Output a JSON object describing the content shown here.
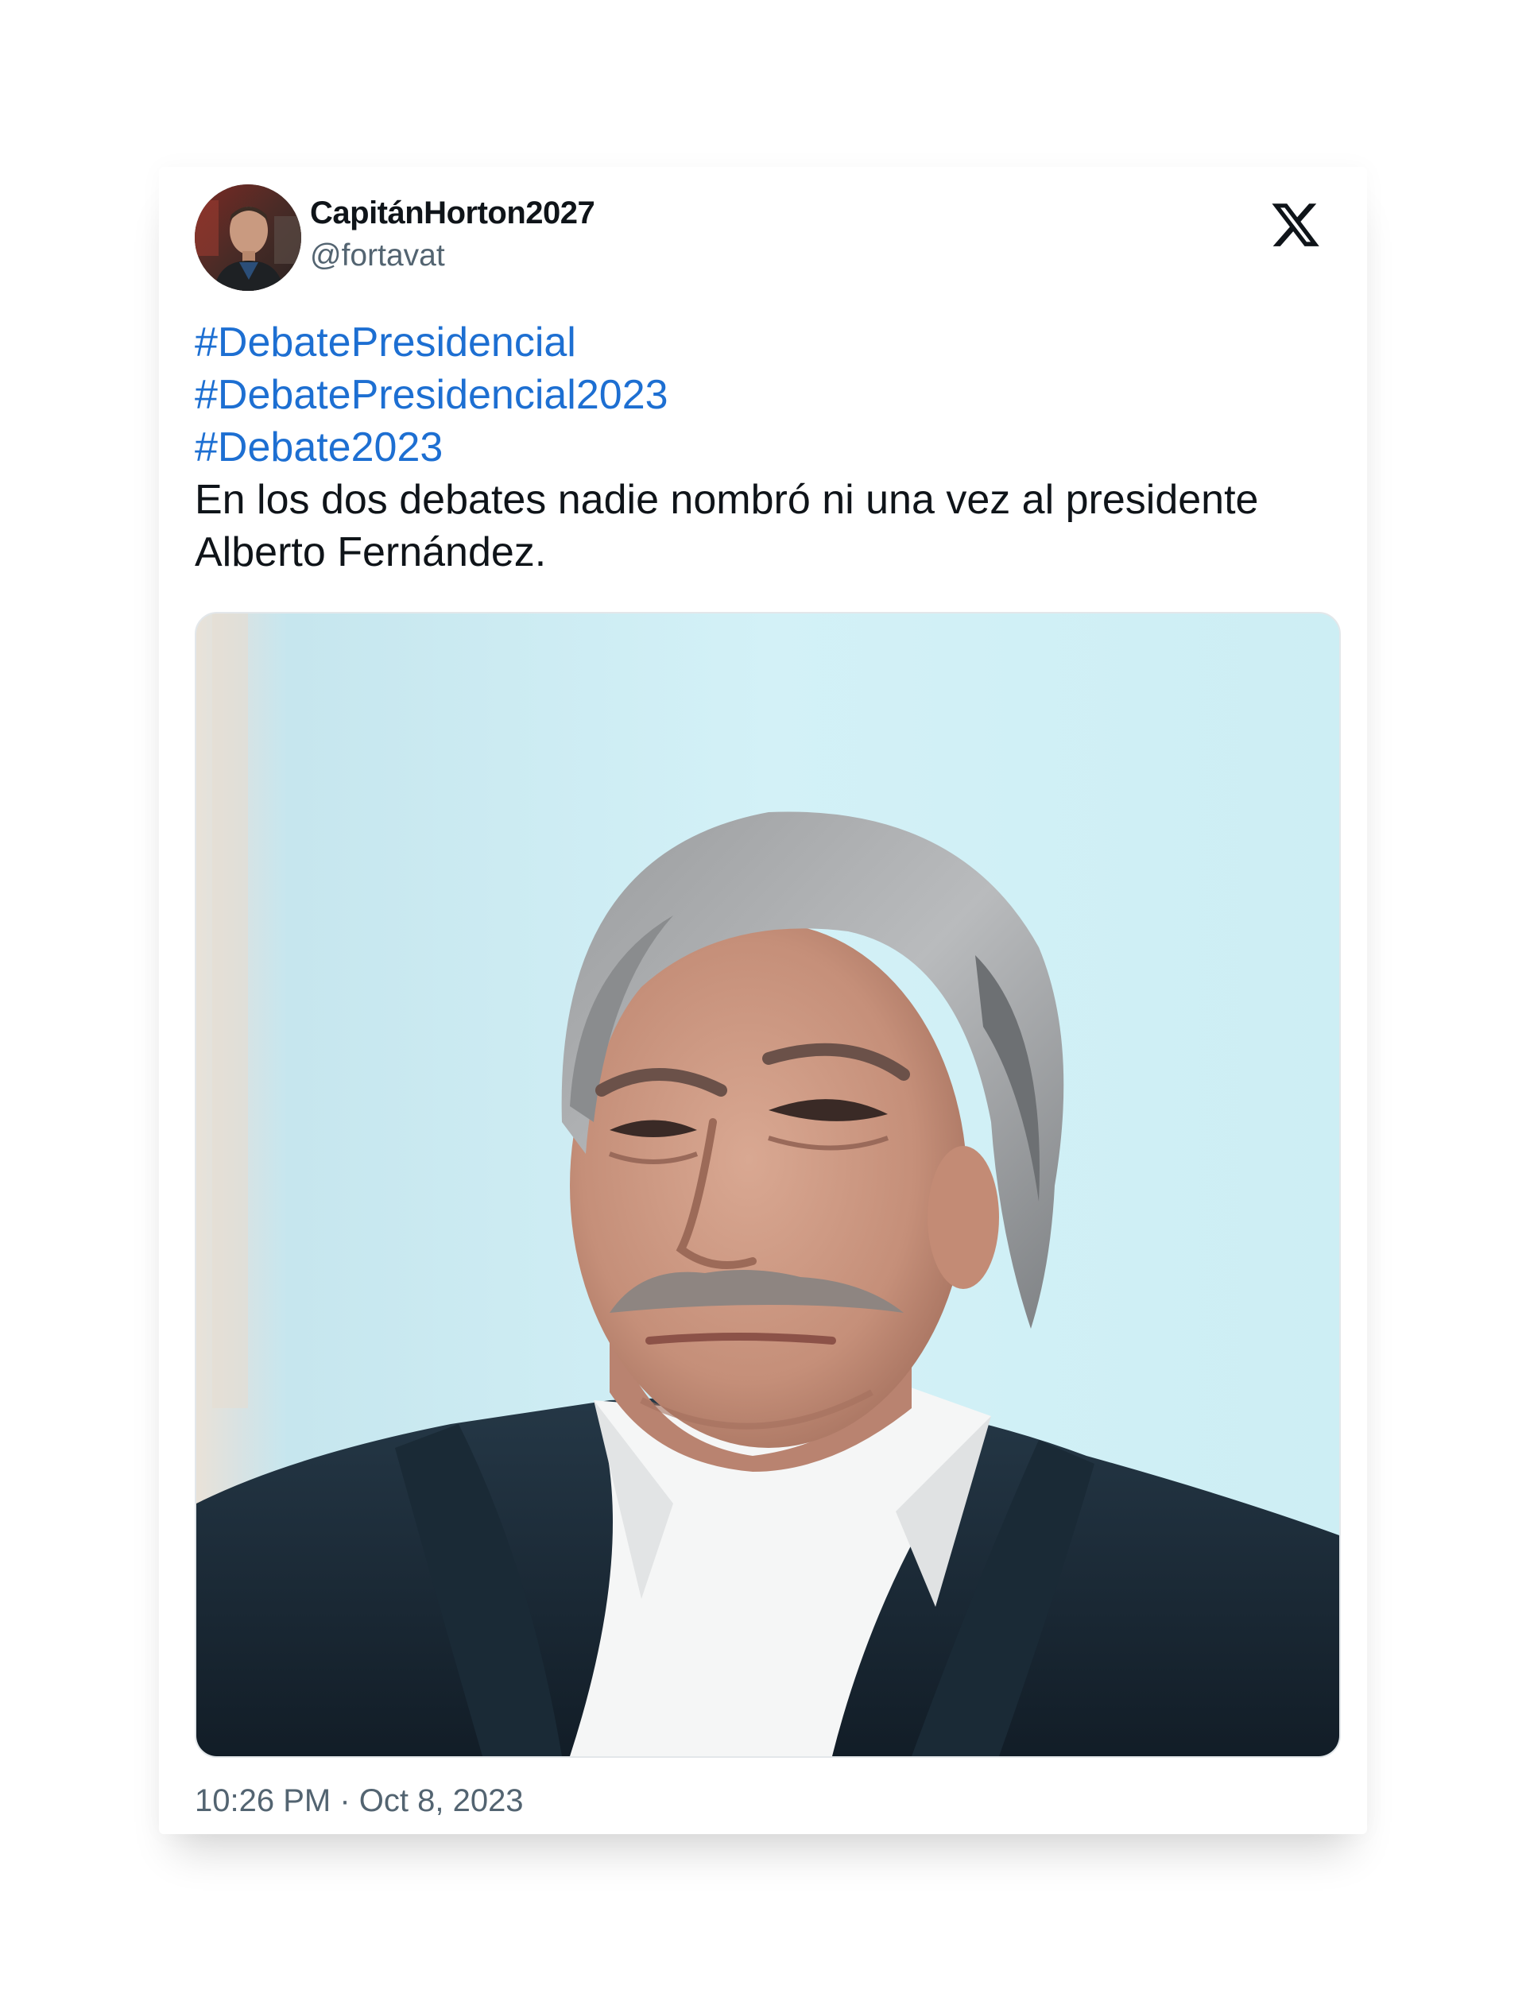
{
  "tweet": {
    "author": {
      "display_name": "CapitánHorton2027",
      "handle": "@fortavat"
    },
    "platform_icon": "x-logo-icon",
    "hashtags": [
      "#DebatePresidencial",
      "#DebatePresidencial2023",
      "#Debate2023"
    ],
    "body": [
      "En los dos debates nadie nombró ni una vez al presidente",
      "Alberto Fernández."
    ],
    "media": {
      "type": "photo",
      "icon": "photo-image"
    },
    "timestamp": "10:26 PM · Oct 8, 2023"
  },
  "colors": {
    "hashtag": "#1d6fd2",
    "text": "#0f1419",
    "secondary": "#536471",
    "photo_background": "#cfeef4"
  }
}
